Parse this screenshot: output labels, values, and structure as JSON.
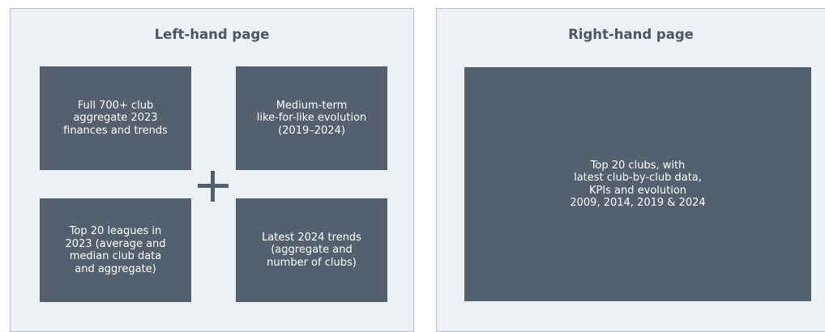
{
  "left_page": {
    "title": "Left-hand page",
    "boxes": [
      "Full 700+ club\naggregate 2023\nfinances and trends",
      "Medium-term\nlike-for-like evolution\n(2019–2024)",
      "Top 20 leagues in\n2023 (average and\nmedian club data\nand aggregate)",
      "Latest 2024 trends\n(aggregate and\nnumber of clubs)"
    ]
  },
  "right_page": {
    "title": "Right-hand page",
    "box": "Top 20 clubs, with\nlatest club-by-club data,\nKPIs and evolution\n2009, 2014, 2019 & 2024"
  },
  "colors": {
    "panel_bg": "#edf0f4",
    "box_bg": "#526070",
    "title_text": "#4a5766"
  }
}
